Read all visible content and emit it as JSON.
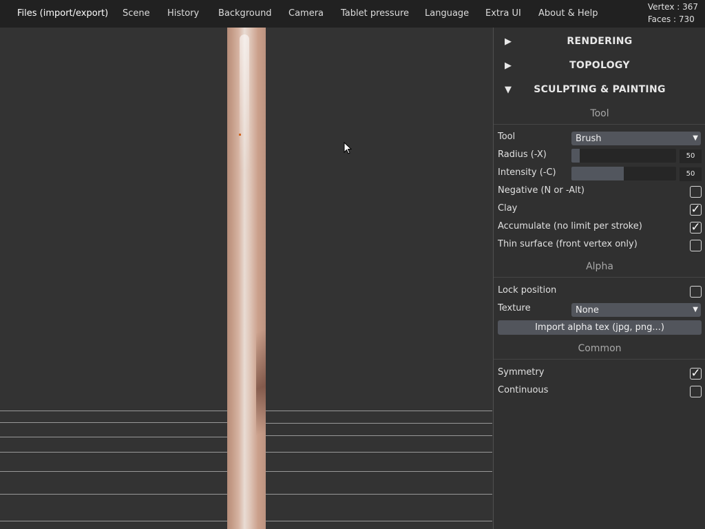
{
  "menu": {
    "items": [
      "Files (import/export)",
      "Scene",
      "History",
      "Background",
      "Camera",
      "Tablet pressure",
      "Language",
      "Extra UI",
      "About & Help"
    ]
  },
  "stats": {
    "vertex": "Vertex : 367",
    "faces": "Faces : 730"
  },
  "panel": {
    "folders": {
      "rendering": {
        "label": "RENDERING",
        "arrow": "▶"
      },
      "topology": {
        "label": "TOPOLOGY",
        "arrow": "▶"
      },
      "sculpting": {
        "label": "SCULPTING & PAINTING",
        "arrow": "▼"
      }
    },
    "tool_section": {
      "title": "Tool",
      "tool_label": "Tool",
      "tool_value": "Brush",
      "radius_label": "Radius (-X)",
      "radius_value": "50",
      "radius_fill": 0.08,
      "intensity_label": "Intensity (-C)",
      "intensity_value": "50",
      "intensity_fill": 0.5,
      "checks": [
        {
          "label": "Negative (N or -Alt)",
          "checked": false
        },
        {
          "label": "Clay",
          "checked": true
        },
        {
          "label": "Accumulate (no limit per stroke)",
          "checked": true
        },
        {
          "label": "Thin surface (front vertex only)",
          "checked": false
        }
      ]
    },
    "alpha_section": {
      "title": "Alpha",
      "lock_label": "Lock position",
      "lock_checked": false,
      "texture_label": "Texture",
      "texture_value": "None",
      "import_button": "Import alpha tex (jpg, png...)"
    },
    "common_section": {
      "title": "Common",
      "symmetry_label": "Symmetry",
      "symmetry_checked": true,
      "continuous_label": "Continuous",
      "continuous_checked": false
    }
  },
  "colors": {
    "menubar_bg": "#212121",
    "viewport_bg": "#333333",
    "panel_bg": "#303030",
    "control_bg": "#52555c",
    "mesh_skin": "#d6b4a3"
  }
}
